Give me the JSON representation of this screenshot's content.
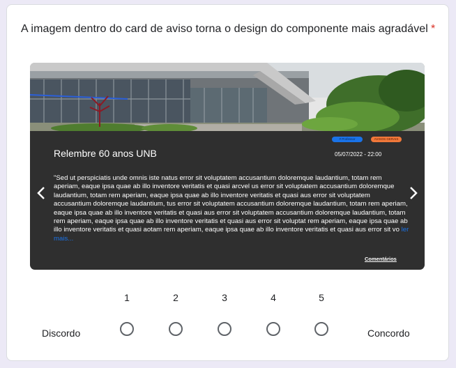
{
  "question": {
    "text": "A imagem dentro do card de aviso torna o design do componente mais agradável",
    "required_mark": "*"
  },
  "notice_card": {
    "title": "Relembre 60 anos UNB",
    "date": "05/07/2022 - 22:00",
    "tags": [
      "# Professor",
      "AVISOS GERAIS"
    ],
    "body": "\"Sed ut perspiciatis unde omnis iste natus error sit voluptatem accusantium doloremque laudantium, totam rem aperiam, eaque ipsa quae ab illo inventore veritatis et quasi arcvel us error sit voluptatem accusantium doloremque laudantium, totam rem aperiam, eaque ipsa quae ab illo inventore veritatis et quasi aus error sit voluptatem accusantium doloremque laudantium, tus error sit voluptatem accusantium doloremque laudantium, totam rem aperiam, eaque ipsa quae ab illo inventore veritatis et quasi aus error sit voluptatem accusantium doloremque laudantium, totam rem aperiam, eaque ipsa quae ab illo inventore veritatis et quasi aus error sit voluptat rem aperiam, eaque ipsa quae ab illo inventore veritatis et quasi aotam rem aperiam, eaque ipsa quae ab illo inventore veritatis et quasi aus error sit vo",
    "read_more": "ler mais...",
    "comments_link": "Comentários",
    "prev_icon": "chevron-left-icon",
    "next_icon": "chevron-right-icon"
  },
  "scale": {
    "min_label": "Discordo",
    "max_label": "Concordo",
    "options": [
      "1",
      "2",
      "3",
      "4",
      "5"
    ]
  },
  "colors": {
    "required": "#d93025",
    "card_bg": "#2f2f2f",
    "link": "#1a73e8",
    "page_bg": "#ece9f6"
  }
}
